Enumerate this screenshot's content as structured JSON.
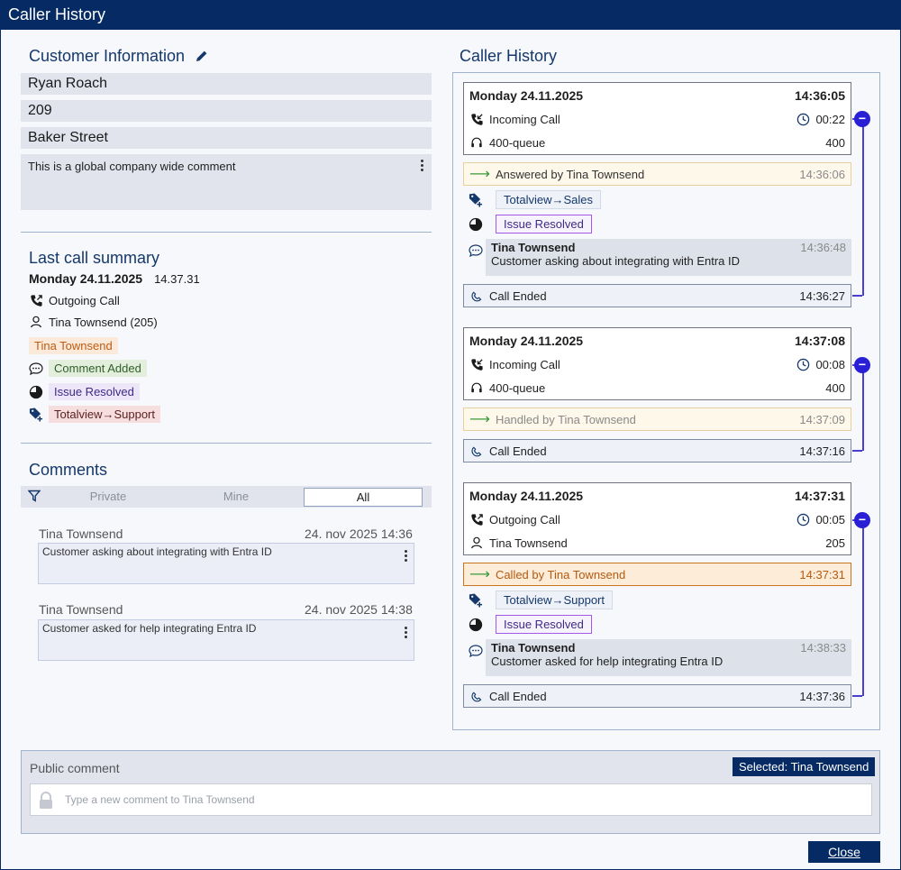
{
  "window": {
    "title": "Caller History"
  },
  "customer": {
    "heading": "Customer Information",
    "name": "Ryan Roach",
    "number": "209",
    "street": "Baker Street",
    "comment": "This is a global company wide comment"
  },
  "summary": {
    "heading": "Last call summary",
    "date": "Monday 24.11.2025",
    "time": "14.37.31",
    "call_type": "Outgoing Call",
    "agent": "Tina Townsend (205)",
    "agent_tag": "Tina Townsend",
    "comment_tag": "Comment Added",
    "status_tag": "Issue Resolved",
    "transfer_tag": "Totalview→Support"
  },
  "comments": {
    "heading": "Comments",
    "filters": [
      "Private",
      "Mine",
      "All"
    ],
    "items": [
      {
        "author": "Tina Townsend",
        "date": "24. nov 2025 14:36",
        "text": "Customer asking about integrating with Entra ID"
      },
      {
        "author": "Tina Townsend",
        "date": "24. nov 2025 14:38",
        "text": "Customer asked for help integrating Entra ID"
      }
    ]
  },
  "history": {
    "heading": "Caller History",
    "calls": [
      {
        "date": "Monday 24.11.2025",
        "time": "14:36:05",
        "type": "Incoming Call",
        "duration": "00:22",
        "queue": "400-queue",
        "queue_id": "400",
        "event": "Answered by Tina Townsend",
        "event_time": "14:36:06",
        "tag": "Totalview→Sales",
        "status": "Issue Resolved",
        "note_author": "Tina Townsend",
        "note_time": "14:36:48",
        "note_text": "Customer asking about integrating with Entra ID",
        "ended": "Call Ended",
        "ended_time": "14:36:27"
      },
      {
        "date": "Monday 24.11.2025",
        "time": "14:37:08",
        "type": "Incoming Call",
        "duration": "00:08",
        "queue": "400-queue",
        "queue_id": "400",
        "event": "Handled by Tina Townsend",
        "event_time": "14:37:09",
        "ended": "Call Ended",
        "ended_time": "14:37:16"
      },
      {
        "date": "Monday 24.11.2025",
        "time": "14:37:31",
        "type": "Outgoing Call",
        "duration": "00:05",
        "agent": "Tina Townsend",
        "agent_id": "205",
        "event": "Called by Tina Townsend",
        "event_time": "14:37:31",
        "tag": "Totalview→Support",
        "status": "Issue Resolved",
        "note_author": "Tina Townsend",
        "note_time": "14:38:33",
        "note_text": "Customer asked for help integrating Entra ID",
        "ended": "Call Ended",
        "ended_time": "14:37:36"
      }
    ]
  },
  "public_comment": {
    "label": "Public comment",
    "selected": "Selected: Tina Townsend",
    "placeholder": "Type a new comment to Tina Townsend"
  },
  "close_label": "Close"
}
